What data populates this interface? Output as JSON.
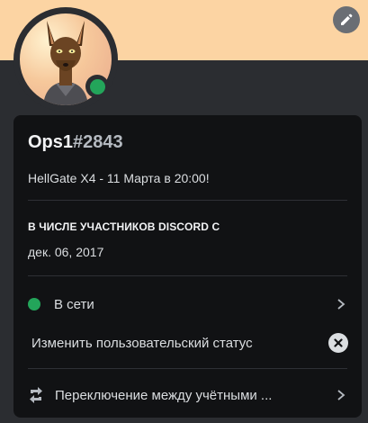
{
  "profile": {
    "username": "Ops1",
    "discriminator": "#2843",
    "custom_status": "HellGate X4 - 11 Марта в 20:00!",
    "presence": "online"
  },
  "member_since": {
    "heading": "В ЧИСЛЕ УЧАСТНИКОВ DISCORD С",
    "date": "дек. 06, 2017"
  },
  "menu": {
    "status_label": "В сети",
    "edit_status_label": "Изменить пользовательский статус",
    "switch_accounts_label": "Переключение между учётными ..."
  },
  "icons": {
    "edit": "pencil-icon",
    "online": "online-status-icon",
    "chevron": "chevron-right-icon",
    "clear": "close-circle-icon",
    "switch": "switch-accounts-icon"
  },
  "colors": {
    "banner": "#fcd4a3",
    "background": "#2b2d31",
    "card": "#111214",
    "online": "#23a55a"
  }
}
